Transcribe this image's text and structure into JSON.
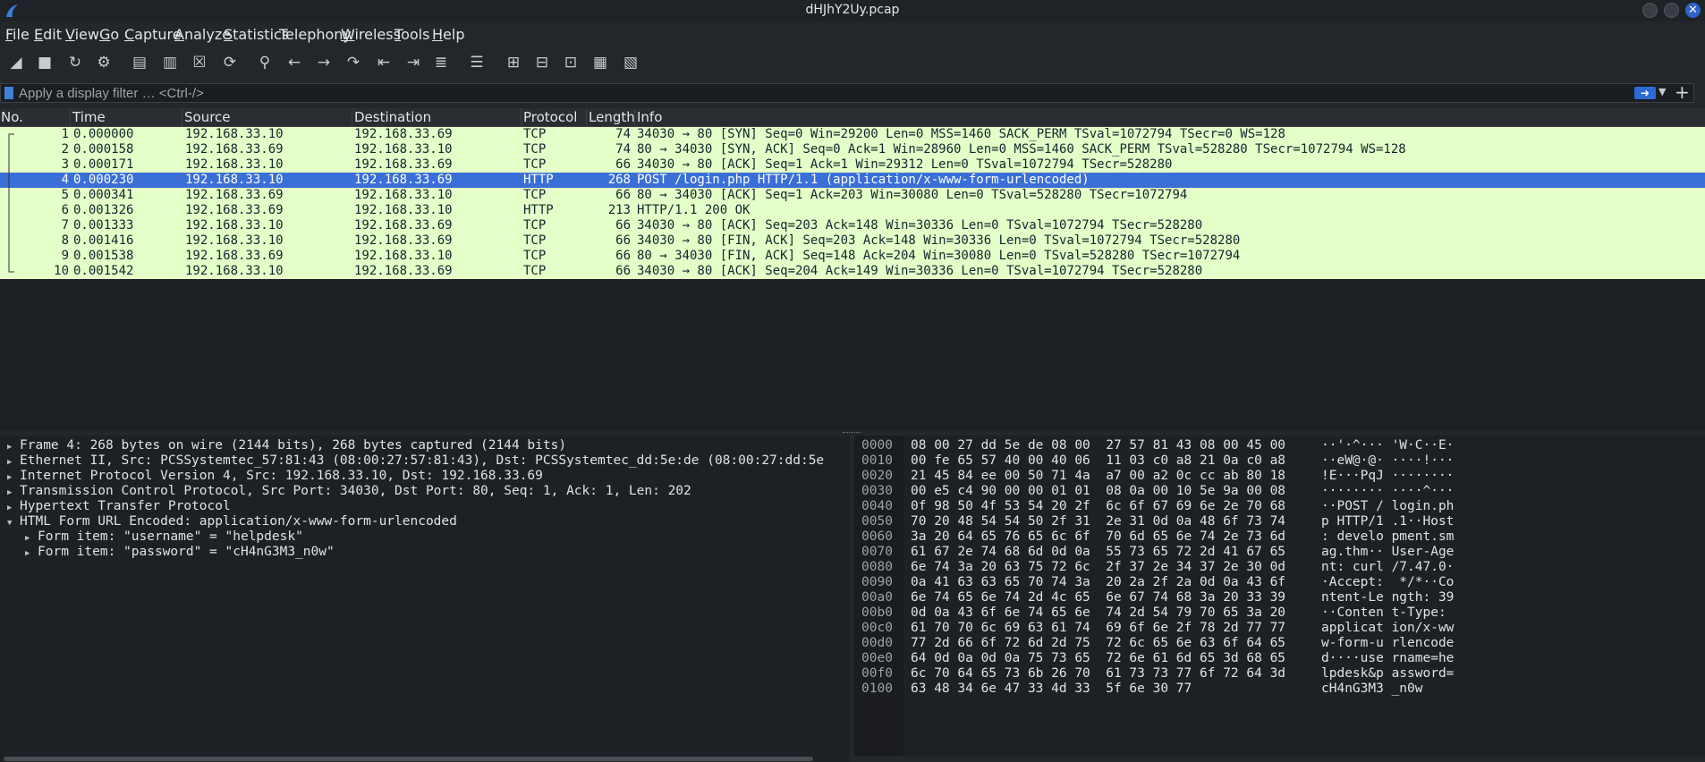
{
  "window": {
    "title": "dHJhY2Uy.pcap",
    "close_glyph": "✕"
  },
  "menu": [
    {
      "label": "File",
      "accel": "F"
    },
    {
      "label": "Edit",
      "accel": "E"
    },
    {
      "label": "View",
      "accel": "V"
    },
    {
      "label": "Go",
      "accel": "G"
    },
    {
      "label": "Capture",
      "accel": "C"
    },
    {
      "label": "Analyze",
      "accel": "A"
    },
    {
      "label": "Statistics",
      "accel": "S"
    },
    {
      "label": "Telephony",
      "accel": "y"
    },
    {
      "label": "Wireless",
      "accel": "W"
    },
    {
      "label": "Tools",
      "accel": "T"
    },
    {
      "label": "Help",
      "accel": "H"
    }
  ],
  "toolbar": {
    "icons": [
      "start-capture-icon",
      "stop-capture-icon",
      "restart-capture-icon",
      "capture-options-icon",
      "open-file-icon",
      "save-file-icon",
      "close-file-icon",
      "reload-file-icon",
      "find-packet-icon",
      "go-back-icon",
      "go-forward-icon",
      "go-to-packet-icon",
      "go-first-icon",
      "go-last-icon",
      "auto-scroll-icon",
      "colorize-icon",
      "zoom-in-icon",
      "zoom-out-icon",
      "normal-size-icon",
      "resize-columns-icon",
      "layout-icon"
    ]
  },
  "filter": {
    "placeholder": "Apply a display filter … <Ctrl-/>"
  },
  "packet_list": {
    "columns": [
      "No.",
      "Time",
      "Source",
      "Destination",
      "Protocol",
      "Length",
      "Info"
    ],
    "rows": [
      {
        "no": "1",
        "time": "0.000000",
        "src": "192.168.33.10",
        "dst": "192.168.33.69",
        "proto": "TCP",
        "len": "74",
        "info": "34030 → 80 [SYN] Seq=0 Win=29200 Len=0 MSS=1460 SACK_PERM TSval=1072794 TSecr=0 WS=128",
        "selected": false
      },
      {
        "no": "2",
        "time": "0.000158",
        "src": "192.168.33.69",
        "dst": "192.168.33.10",
        "proto": "TCP",
        "len": "74",
        "info": "80 → 34030 [SYN, ACK] Seq=0 Ack=1 Win=28960 Len=0 MSS=1460 SACK_PERM TSval=528280 TSecr=1072794 WS=128",
        "selected": false
      },
      {
        "no": "3",
        "time": "0.000171",
        "src": "192.168.33.10",
        "dst": "192.168.33.69",
        "proto": "TCP",
        "len": "66",
        "info": "34030 → 80 [ACK] Seq=1 Ack=1 Win=29312 Len=0 TSval=1072794 TSecr=528280",
        "selected": false
      },
      {
        "no": "4",
        "time": "0.000230",
        "src": "192.168.33.10",
        "dst": "192.168.33.69",
        "proto": "HTTP",
        "len": "268",
        "info": "POST /login.php HTTP/1.1  (application/x-www-form-urlencoded)",
        "selected": true
      },
      {
        "no": "5",
        "time": "0.000341",
        "src": "192.168.33.69",
        "dst": "192.168.33.10",
        "proto": "TCP",
        "len": "66",
        "info": "80 → 34030 [ACK] Seq=1 Ack=203 Win=30080 Len=0 TSval=528280 TSecr=1072794",
        "selected": false
      },
      {
        "no": "6",
        "time": "0.001326",
        "src": "192.168.33.69",
        "dst": "192.168.33.10",
        "proto": "HTTP",
        "len": "213",
        "info": "HTTP/1.1 200 OK",
        "selected": false
      },
      {
        "no": "7",
        "time": "0.001333",
        "src": "192.168.33.10",
        "dst": "192.168.33.69",
        "proto": "TCP",
        "len": "66",
        "info": "34030 → 80 [ACK] Seq=203 Ack=148 Win=30336 Len=0 TSval=1072794 TSecr=528280",
        "selected": false
      },
      {
        "no": "8",
        "time": "0.001416",
        "src": "192.168.33.10",
        "dst": "192.168.33.69",
        "proto": "TCP",
        "len": "66",
        "info": "34030 → 80 [FIN, ACK] Seq=203 Ack=148 Win=30336 Len=0 TSval=1072794 TSecr=528280",
        "selected": false
      },
      {
        "no": "9",
        "time": "0.001538",
        "src": "192.168.33.69",
        "dst": "192.168.33.10",
        "proto": "TCP",
        "len": "66",
        "info": "80 → 34030 [FIN, ACK] Seq=148 Ack=204 Win=30080 Len=0 TSval=528280 TSecr=1072794",
        "selected": false
      },
      {
        "no": "10",
        "time": "0.001542",
        "src": "192.168.33.10",
        "dst": "192.168.33.69",
        "proto": "TCP",
        "len": "66",
        "info": "34030 → 80 [ACK] Seq=204 Ack=149 Win=30336 Len=0 TSval=1072794 TSecr=528280",
        "selected": false
      }
    ]
  },
  "details": [
    {
      "text": "Frame 4: 268 bytes on wire (2144 bits), 268 bytes captured (2144 bits)",
      "expanded": false,
      "level": 0
    },
    {
      "text": "Ethernet II, Src: PCSSystemtec_57:81:43 (08:00:27:57:81:43), Dst: PCSSystemtec_dd:5e:de (08:00:27:dd:5e",
      "expanded": false,
      "level": 0
    },
    {
      "text": "Internet Protocol Version 4, Src: 192.168.33.10, Dst: 192.168.33.69",
      "expanded": false,
      "level": 0
    },
    {
      "text": "Transmission Control Protocol, Src Port: 34030, Dst Port: 80, Seq: 1, Ack: 1, Len: 202",
      "expanded": false,
      "level": 0
    },
    {
      "text": "Hypertext Transfer Protocol",
      "expanded": false,
      "level": 0
    },
    {
      "text": "HTML Form URL Encoded: application/x-www-form-urlencoded",
      "expanded": true,
      "level": 0
    },
    {
      "text": "Form item: \"username\" = \"helpdesk\"",
      "expanded": false,
      "level": 1
    },
    {
      "text": "Form item: \"password\" = \"cH4nG3M3_n0w\"",
      "expanded": false,
      "level": 1
    }
  ],
  "hex": [
    {
      "off": "0000",
      "hex": "08 00 27 dd 5e de 08 00  27 57 81 43 08 00 45 00",
      "ascii": "··'·^··· 'W·C··E·"
    },
    {
      "off": "0010",
      "hex": "00 fe 65 57 40 00 40 06  11 03 c0 a8 21 0a c0 a8",
      "ascii": "··eW@·@· ····!···"
    },
    {
      "off": "0020",
      "hex": "21 45 84 ee 00 50 71 4a  a7 00 a2 0c cc ab 80 18",
      "ascii": "!E···PqJ ········"
    },
    {
      "off": "0030",
      "hex": "00 e5 c4 90 00 00 01 01  08 0a 00 10 5e 9a 00 08",
      "ascii": "········ ····^···"
    },
    {
      "off": "0040",
      "hex": "0f 98 50 4f 53 54 20 2f  6c 6f 67 69 6e 2e 70 68",
      "ascii": "··POST / login.ph"
    },
    {
      "off": "0050",
      "hex": "70 20 48 54 54 50 2f 31  2e 31 0d 0a 48 6f 73 74",
      "ascii": "p HTTP/1 .1··Host"
    },
    {
      "off": "0060",
      "hex": "3a 20 64 65 76 65 6c 6f  70 6d 65 6e 74 2e 73 6d",
      "ascii": ": develo pment.sm"
    },
    {
      "off": "0070",
      "hex": "61 67 2e 74 68 6d 0d 0a  55 73 65 72 2d 41 67 65",
      "ascii": "ag.thm·· User-Age"
    },
    {
      "off": "0080",
      "hex": "6e 74 3a 20 63 75 72 6c  2f 37 2e 34 37 2e 30 0d",
      "ascii": "nt: curl /7.47.0·"
    },
    {
      "off": "0090",
      "hex": "0a 41 63 63 65 70 74 3a  20 2a 2f 2a 0d 0a 43 6f",
      "ascii": "·Accept:  */*··Co"
    },
    {
      "off": "00a0",
      "hex": "6e 74 65 6e 74 2d 4c 65  6e 67 74 68 3a 20 33 39",
      "ascii": "ntent-Le ngth: 39"
    },
    {
      "off": "00b0",
      "hex": "0d 0a 43 6f 6e 74 65 6e  74 2d 54 79 70 65 3a 20",
      "ascii": "··Conten t-Type: "
    },
    {
      "off": "00c0",
      "hex": "61 70 70 6c 69 63 61 74  69 6f 6e 2f 78 2d 77 77",
      "ascii": "applicat ion/x-ww"
    },
    {
      "off": "00d0",
      "hex": "77 2d 66 6f 72 6d 2d 75  72 6c 65 6e 63 6f 64 65",
      "ascii": "w-form-u rlencode"
    },
    {
      "off": "00e0",
      "hex": "64 0d 0a 0d 0a 75 73 65  72 6e 61 6d 65 3d 68 65",
      "ascii": "d····use rname=he"
    },
    {
      "off": "00f0",
      "hex": "6c 70 64 65 73 6b 26 70  61 73 73 77 6f 72 64 3d",
      "ascii": "lpdesk&p assword="
    },
    {
      "off": "0100",
      "hex": "63 48 34 6e 47 33 4d 33  5f 6e 30 77",
      "ascii": "cH4nG3M3 _n0w"
    }
  ],
  "colors": {
    "row_tcp_http": "#e4ffc7",
    "row_selected": "#3a6fd8",
    "accent": "#2f62c9"
  }
}
